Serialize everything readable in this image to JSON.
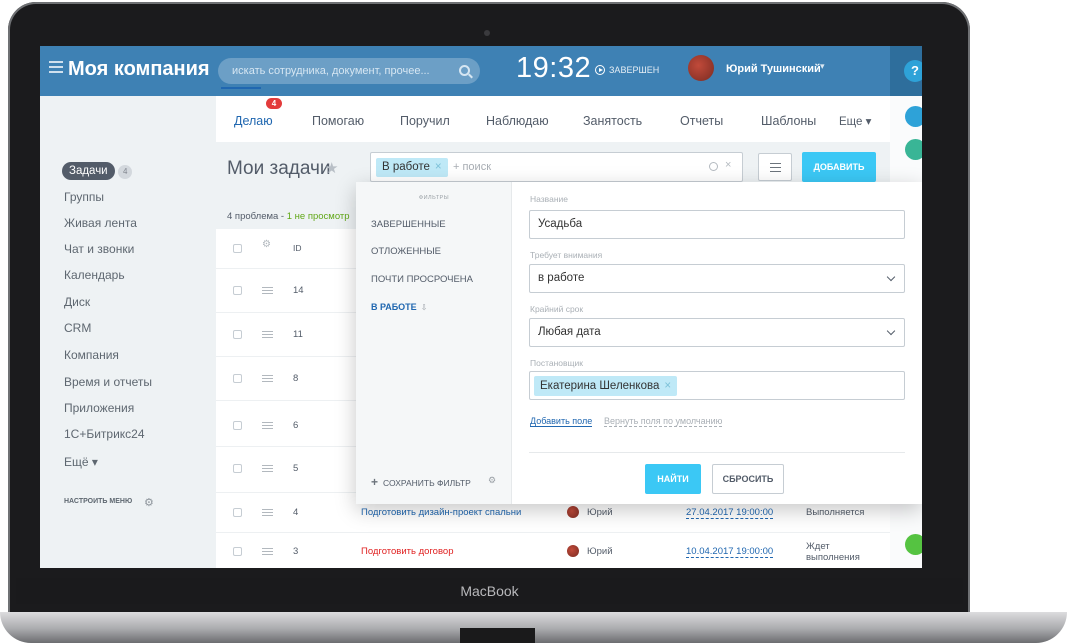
{
  "device": {
    "label": "MacBook"
  },
  "topbar": {
    "company": "Моя компания",
    "search_placeholder": "искать сотрудника, документ, прочее...",
    "clock": "19:32",
    "status": "ЗАВЕРШЕН",
    "user_name": "Юрий Тушинский",
    "user_caret": "▾",
    "help": "?"
  },
  "left_menu": {
    "active_label": "Задачи",
    "active_count": "4",
    "items": [
      "Группы",
      "Живая лента",
      "Чат и звонки",
      "Календарь",
      "Диск",
      "CRM",
      "Компания",
      "Время и отчеты",
      "Приложения",
      "1С+Битрикс24",
      "Ещё ▾"
    ],
    "configure": "НАСТРОИТЬ МЕНЮ"
  },
  "tabs": {
    "items": [
      "Делаю",
      "Помогаю",
      "Поручил",
      "Наблюдаю",
      "Занятость",
      "Отчеты",
      "Шаблоны",
      "Еще ▾"
    ],
    "badge": "4"
  },
  "page": {
    "title": "Мои задачи",
    "filter_chip": "В работе",
    "filter_placeholder": "+ поиск",
    "add_button": "ДОБАВИТЬ",
    "problems_text": "4 проблема - ",
    "problems_link": "1 не просмотр"
  },
  "table": {
    "header_id": "ID",
    "rows": [
      {
        "id": "14"
      },
      {
        "id": "11"
      },
      {
        "id": "8"
      },
      {
        "id": "6"
      },
      {
        "id": "5"
      },
      {
        "id": "4",
        "name": "Подготовить дизайн-проект спальни",
        "responsible": "Юрий",
        "deadline": "27.04.2017 19:00:00",
        "status": "Выполняется"
      },
      {
        "id": "3",
        "name": "Подготовить договор",
        "responsible": "Юрий",
        "deadline": "10.04.2017 19:00:00",
        "status": "Ждет выполнения"
      }
    ]
  },
  "filter_popup": {
    "side_title": "ФИЛЬТРЫ",
    "presets": [
      "ЗАВЕРШЕННЫЕ",
      "ОТЛОЖЕННЫЕ",
      "ПОЧТИ ПРОСРОЧЕНА"
    ],
    "active_preset": "В РАБОТЕ",
    "save_filter": "СОХРАНИТЬ ФИЛЬТР",
    "fields": {
      "name_label": "Название",
      "name_value": "Усадьба",
      "attention_label": "Требует внимания",
      "attention_value": "в работе",
      "deadline_label": "Крайний срок",
      "deadline_value": "Любая дата",
      "creator_label": "Постановщик",
      "creator_value": "Екатерина Шеленкова"
    },
    "add_field": "Добавить поле",
    "reset_fields": "Вернуть поля по умолчанию",
    "find_button": "НАЙТИ",
    "reset_button": "СБРОСИТЬ"
  },
  "colors": {
    "topbar": "#3e81b4",
    "accent_button": "#3bc8f5",
    "link": "#2067b0",
    "badge": "#e33b3b",
    "chip": "#bfe9f7"
  }
}
